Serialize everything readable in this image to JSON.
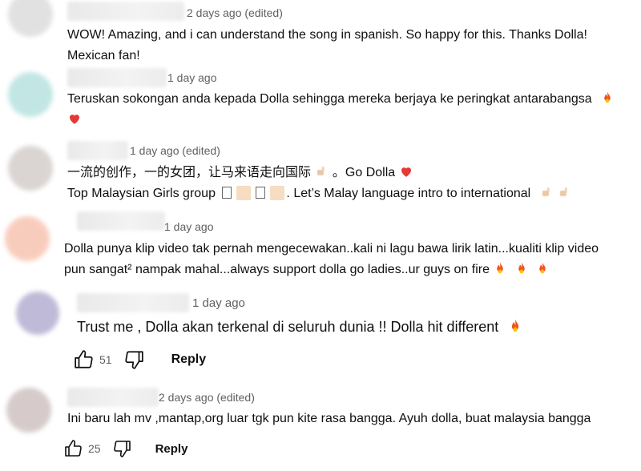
{
  "comments": [
    {
      "meta": "2 days ago (edited)",
      "lines": [
        "WOW! Amazing, and i can understand the song in spanish. So happy for this. Thanks Dolla!",
        "Mexican fan!"
      ]
    },
    {
      "meta": "1 day ago",
      "lines": [
        "Teruskan sokongan anda kepada Dolla sehingga mereka berjaya ke peringkat antarabangsa"
      ]
    },
    {
      "meta": "1 day ago (edited)",
      "line1": "一流的创作，一的女团，让马来语走向国际",
      "line1b": "。Go Dolla",
      "line2a": "Top Malaysian Girls group",
      "line2b": ". Let’s Malay language intro to international"
    },
    {
      "meta": "1 day ago",
      "lines": [
        "Dolla punya klip video tak pernah mengecewakan..kali ni lagu bawa lirik latin...kualiti klip video",
        "pun sangat² nampak mahal...always support dolla go ladies..ur guys on fire"
      ]
    },
    {
      "meta": "1 day ago",
      "text": "Trust me , Dolla akan terkenal di seluruh dunia !! Dolla hit different",
      "likes": "51",
      "reply_label": "Reply"
    },
    {
      "meta": "2 days ago (edited)",
      "text": "Ini baru lah mv ,mantap,org luar tgk pun kite rasa bangga. Ayuh dolla, buat malaysia bangga",
      "likes": "25",
      "reply_label": "Reply"
    }
  ],
  "colors": {
    "text": "#0f0f0f",
    "meta": "#606060",
    "fire": "#f4511e",
    "heart": "#e53935"
  },
  "icons": [
    "thumb-up-icon",
    "thumb-down-icon",
    "fire-emoji-icon",
    "heart-emoji-icon",
    "thumbs-up-emoji-icon"
  ]
}
